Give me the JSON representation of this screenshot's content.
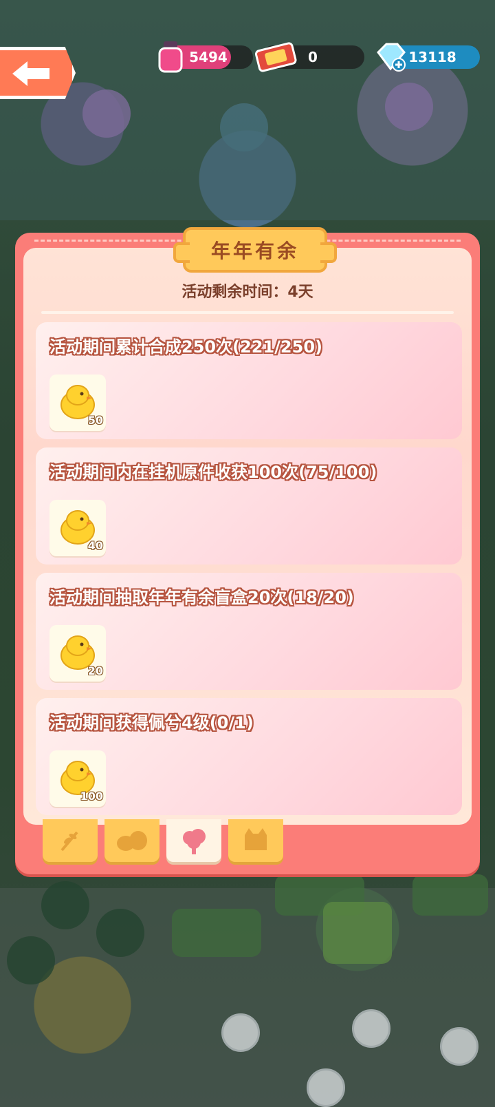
{
  "hud": {
    "back_icon": "back-arrow-icon",
    "ink": {
      "icon": "ink-bottle-icon",
      "value": "5494"
    },
    "ticket": {
      "icon": "ticket-icon",
      "value": "0"
    },
    "gems": {
      "icon": "gem-plus-icon",
      "value": "13118"
    }
  },
  "panel": {
    "title": "年年有余",
    "timer": "活动剩余时间：4天",
    "tasks": [
      {
        "desc": "活动期间累计合成250次(221/250)",
        "reward_icon": "yellow-chick-icon",
        "reward_qty": "50"
      },
      {
        "desc": "活动期间内在挂机原件收获100次(75/100)",
        "reward_icon": "yellow-chick-icon",
        "reward_qty": "40"
      },
      {
        "desc": "活动期间抽取年年有余盲盒20次(18/20)",
        "reward_icon": "yellow-chick-icon",
        "reward_qty": "20"
      },
      {
        "desc": "活动期间获得佩兮4级(0/1)",
        "reward_icon": "yellow-chick-icon",
        "reward_qty": "100"
      }
    ],
    "tabs": [
      {
        "icon": "branch-icon",
        "active": false
      },
      {
        "icon": "stones-icon",
        "active": false
      },
      {
        "icon": "tree-icon",
        "active": true
      },
      {
        "icon": "cat-icon",
        "active": false
      }
    ]
  },
  "colors": {
    "panel": "#fb7d78",
    "title_plate": "#ffc95a",
    "task_text_outline": "#b6543f",
    "back_button": "#ff7a55"
  }
}
